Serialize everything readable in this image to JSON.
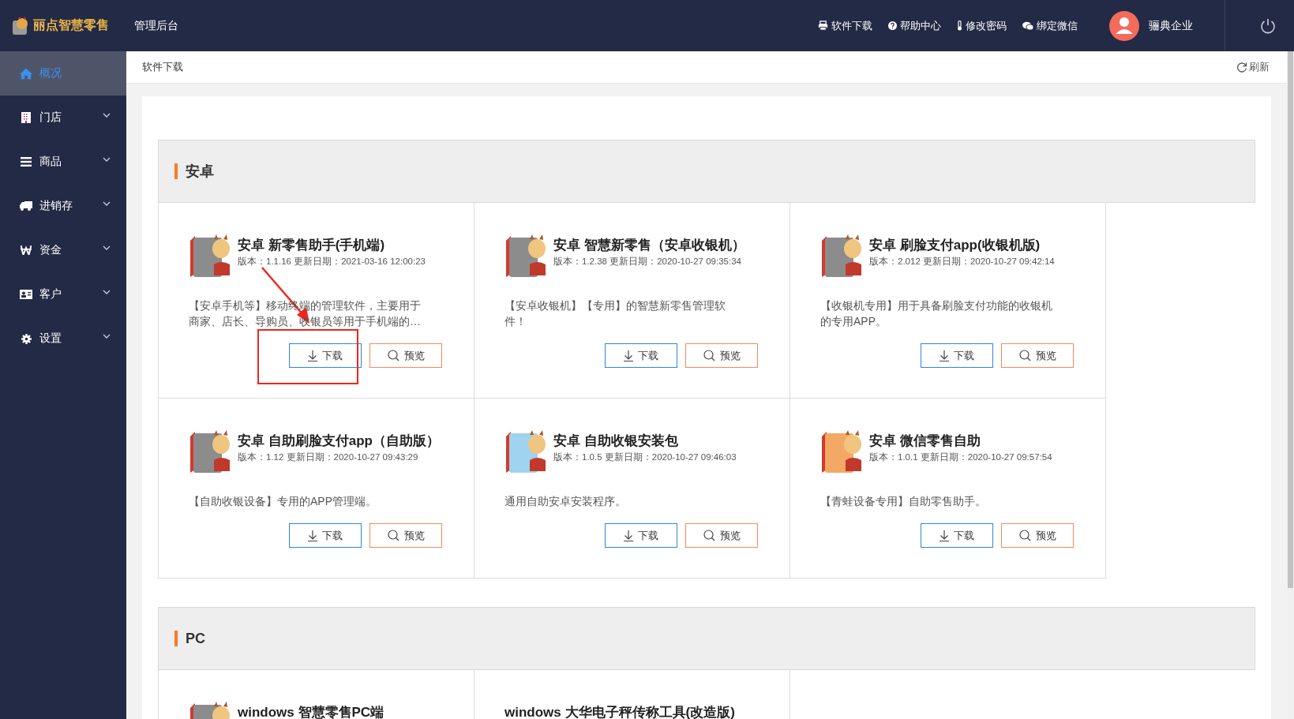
{
  "header": {
    "logo_text": "丽点智慧零售",
    "title": "管理后台",
    "links": [
      {
        "kind": "download",
        "label": "软件下载"
      },
      {
        "kind": "help",
        "label": "帮助中心"
      },
      {
        "kind": "password",
        "label": "修改密码"
      },
      {
        "kind": "wechat",
        "label": "绑定微信"
      }
    ],
    "user": "骊典企业"
  },
  "sidebar": {
    "items": [
      {
        "kind": "home",
        "label": "概况",
        "selected": true,
        "expandable": false
      },
      {
        "kind": "store",
        "label": "门店",
        "selected": false,
        "expandable": true
      },
      {
        "kind": "list",
        "label": "商品",
        "selected": false,
        "expandable": true
      },
      {
        "kind": "truck",
        "label": "进销存",
        "selected": false,
        "expandable": true
      },
      {
        "kind": "money",
        "label": "资金",
        "selected": false,
        "expandable": true
      },
      {
        "kind": "card",
        "label": "客户",
        "selected": false,
        "expandable": true
      },
      {
        "kind": "gear",
        "label": "设置",
        "selected": false,
        "expandable": true
      }
    ]
  },
  "breadcrumb": "软件下载",
  "refresh": "刷新",
  "sections": [
    {
      "title": "安卓",
      "cards": [
        {
          "title": "安卓 新零售助手(手机端)",
          "meta": "版本：1.1.16 更新日期：2021-03-16 12:00:23",
          "description": "【安卓手机等】移动终端的管理软件，主要用于商家、店长、导购员、收银员等用于手机端的…",
          "color": "#8c8c8c",
          "highlighted": true,
          "download": "下载",
          "preview": "预览"
        },
        {
          "title": "安卓 智慧新零售（安卓收银机）",
          "meta": "版本：1.2.38 更新日期：2020-10-27 09:35:34",
          "description": "【安卓收银机】【专用】的智慧新零售管理软件！",
          "color": "#8c8c8c",
          "highlighted": false,
          "download": "下载",
          "preview": "预览"
        },
        {
          "title": "安卓 刷脸支付app(收银机版)",
          "meta": "版本：2.012 更新日期：2020-10-27 09:42:14",
          "description": "【收银机专用】用于具备刷脸支付功能的收银机的专用APP。",
          "color": "#8c8c8c",
          "highlighted": false,
          "download": "下载",
          "preview": "预览"
        },
        {
          "title": "安卓 自助刷脸支付app（自助版）",
          "meta": "版本：1.12 更新日期：2020-10-27 09:43:29",
          "description": "【自助收银设备】专用的APP管理端。",
          "color": "#8c8c8c",
          "highlighted": false,
          "download": "下载",
          "preview": "预览"
        },
        {
          "title": "安卓 自助收银安装包",
          "meta": "版本：1.0.5 更新日期：2020-10-27 09:46:03",
          "description": "通用自助安卓安装程序。",
          "color": "#9fd3f0",
          "highlighted": false,
          "download": "下载",
          "preview": "预览"
        },
        {
          "title": "安卓 微信零售自助",
          "meta": "版本：1.0.1 更新日期：2020-10-27 09:57:54",
          "description": "【青蛙设备专用】自助零售助手。",
          "color": "#f4a865",
          "highlighted": false,
          "download": "下载",
          "preview": "预览"
        }
      ]
    },
    {
      "title": "PC",
      "cards": [
        {
          "title": "windows 智慧零售PC端",
          "color": "#8c8c8c"
        },
        {
          "title": "windows 大华电子秤传称工具(改造版)"
        }
      ]
    }
  ]
}
